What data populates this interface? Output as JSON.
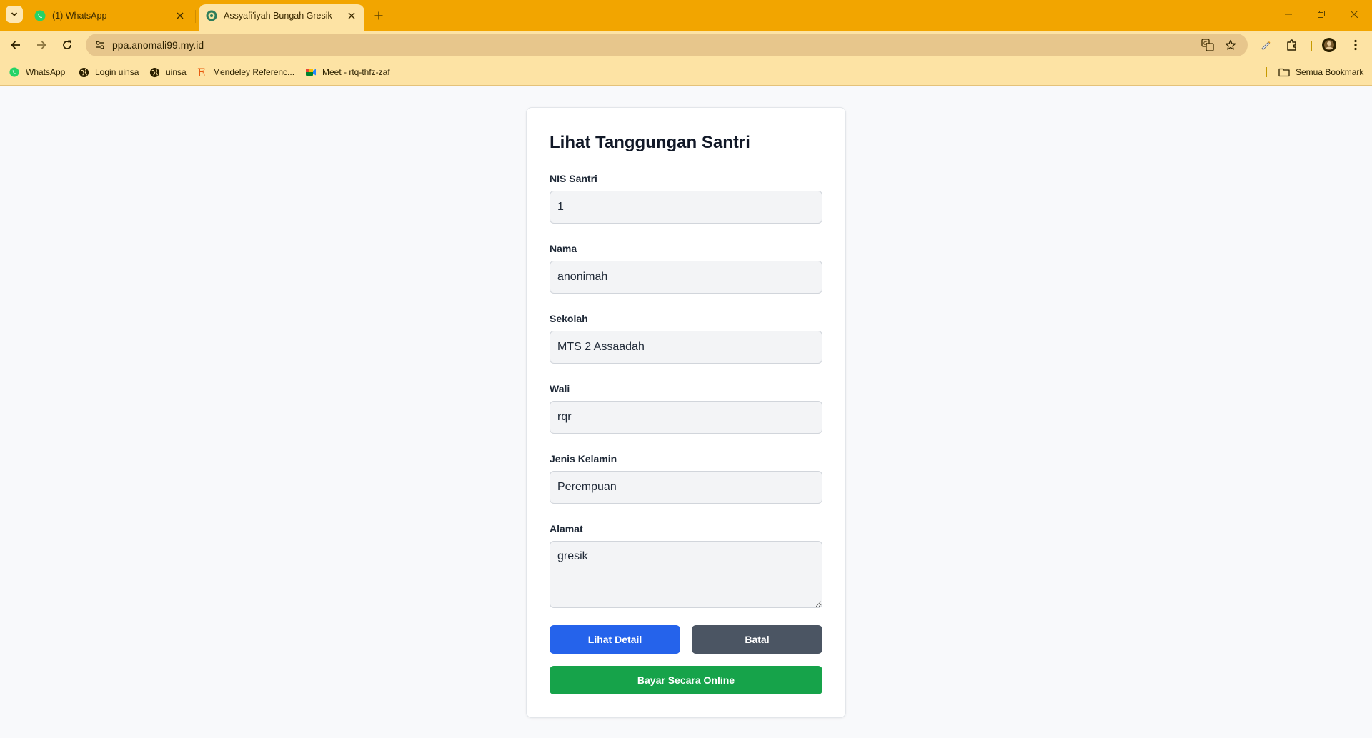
{
  "browser": {
    "tabs": [
      {
        "title": "(1) WhatsApp",
        "icon": "whatsapp-icon"
      },
      {
        "title": "Assyafi'iyah Bungah Gresik",
        "icon": "site-logo-icon"
      }
    ],
    "url": "ppa.anomali99.my.id",
    "bookmarks": [
      {
        "label": "WhatsApp",
        "icon": "whatsapp-icon"
      },
      {
        "label": "Login uinsa",
        "icon": "globe-icon"
      },
      {
        "label": "uinsa",
        "icon": "globe-icon"
      },
      {
        "label": "Mendeley Referenc...",
        "icon": "mendeley-icon"
      },
      {
        "label": "Meet - rtq-thfz-zaf",
        "icon": "meet-icon"
      }
    ],
    "all_bookmarks_label": "Semua Bookmark",
    "colors": {
      "tabstrip": "#f2a500",
      "toolbar": "#fde3a4",
      "omnibox": "#e7c68c"
    }
  },
  "form": {
    "title": "Lihat Tanggungan Santri",
    "fields": [
      {
        "label": "NIS Santri",
        "value": "1"
      },
      {
        "label": "Nama",
        "value": "anonimah"
      },
      {
        "label": "Sekolah",
        "value": "MTS 2 Assaadah"
      },
      {
        "label": "Wali",
        "value": "rqr"
      },
      {
        "label": "Jenis Kelamin",
        "value": "Perempuan"
      }
    ],
    "alamat": {
      "label": "Alamat",
      "value": "gresik"
    },
    "buttons": {
      "detail": "Lihat Detail",
      "batal": "Batal",
      "bayar": "Bayar Secara Online"
    },
    "colors": {
      "detail": "#2563eb",
      "batal": "#4b5563",
      "bayar": "#16a34a"
    }
  }
}
